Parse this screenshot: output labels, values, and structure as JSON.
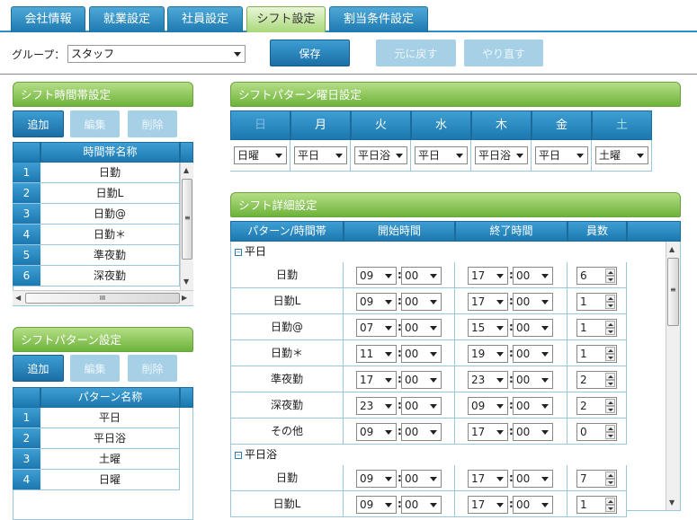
{
  "tabs": [
    "会社情報",
    "就業設定",
    "社員設定",
    "シフト設定",
    "割当条件設定"
  ],
  "toolbar": {
    "group_label": "グループ：",
    "group_value": "スタッフ",
    "save": "保存",
    "undo": "元に戻す",
    "redo": "やり直す"
  },
  "shift_time": {
    "title": "シフト時間帯設定",
    "add": "追加",
    "edit": "編集",
    "delete": "削除",
    "col": "時間帯名称",
    "rows": [
      {
        "n": "1",
        "name": "日勤"
      },
      {
        "n": "2",
        "name": "日勤L"
      },
      {
        "n": "3",
        "name": "日勤@"
      },
      {
        "n": "4",
        "name": "日勤＊"
      },
      {
        "n": "5",
        "name": "準夜勤"
      },
      {
        "n": "6",
        "name": "深夜勤"
      }
    ],
    "hscroll_glyph": "III"
  },
  "shift_pattern": {
    "title": "シフトパターン設定",
    "add": "追加",
    "edit": "編集",
    "delete": "削除",
    "col": "パターン名称",
    "rows": [
      {
        "n": "1",
        "name": "平日"
      },
      {
        "n": "2",
        "name": "平日浴"
      },
      {
        "n": "3",
        "name": "土曜"
      },
      {
        "n": "4",
        "name": "日曜"
      }
    ]
  },
  "weekday": {
    "title": "シフトパターン曜日設定",
    "days": [
      {
        "label": "日",
        "color": "#7dbbe3",
        "value": "日曜"
      },
      {
        "label": "月",
        "color": "#ffffff",
        "value": "平日"
      },
      {
        "label": "火",
        "color": "#ffffff",
        "value": "平日浴"
      },
      {
        "label": "水",
        "color": "#ffffff",
        "value": "平日"
      },
      {
        "label": "木",
        "color": "#ffffff",
        "value": "平日浴"
      },
      {
        "label": "金",
        "color": "#ffffff",
        "value": "平日"
      },
      {
        "label": "土",
        "color": "#9fe0e0",
        "value": "土曜"
      }
    ]
  },
  "detail": {
    "title": "シフト詳細設定",
    "cols": [
      "パターン/時間帯",
      "開始時間",
      "終了時間",
      "員数"
    ],
    "groups": [
      {
        "toggle": "−",
        "name": "平日",
        "rows": [
          {
            "name": "日勤",
            "sh": "09",
            "sm": "00",
            "eh": "17",
            "em": "00",
            "count": "6"
          },
          {
            "name": "日勤L",
            "sh": "09",
            "sm": "00",
            "eh": "17",
            "em": "00",
            "count": "1"
          },
          {
            "name": "日勤@",
            "sh": "07",
            "sm": "00",
            "eh": "15",
            "em": "00",
            "count": "1"
          },
          {
            "name": "日勤＊",
            "sh": "11",
            "sm": "00",
            "eh": "19",
            "em": "00",
            "count": "1"
          },
          {
            "name": "準夜勤",
            "sh": "17",
            "sm": "00",
            "eh": "23",
            "em": "00",
            "count": "2"
          },
          {
            "name": "深夜勤",
            "sh": "23",
            "sm": "00",
            "eh": "09",
            "em": "00",
            "count": "2"
          },
          {
            "name": "その他",
            "sh": "09",
            "sm": "00",
            "eh": "17",
            "em": "00",
            "count": "0"
          }
        ]
      },
      {
        "toggle": "−",
        "name": "平日浴",
        "rows": [
          {
            "name": "日勤",
            "sh": "09",
            "sm": "00",
            "eh": "17",
            "em": "00",
            "count": "7"
          },
          {
            "name": "日勤L",
            "sh": "09",
            "sm": "00",
            "eh": "17",
            "em": "00",
            "count": "1"
          }
        ]
      }
    ],
    "colon": ":",
    "vscroll_glyph": "≡"
  }
}
